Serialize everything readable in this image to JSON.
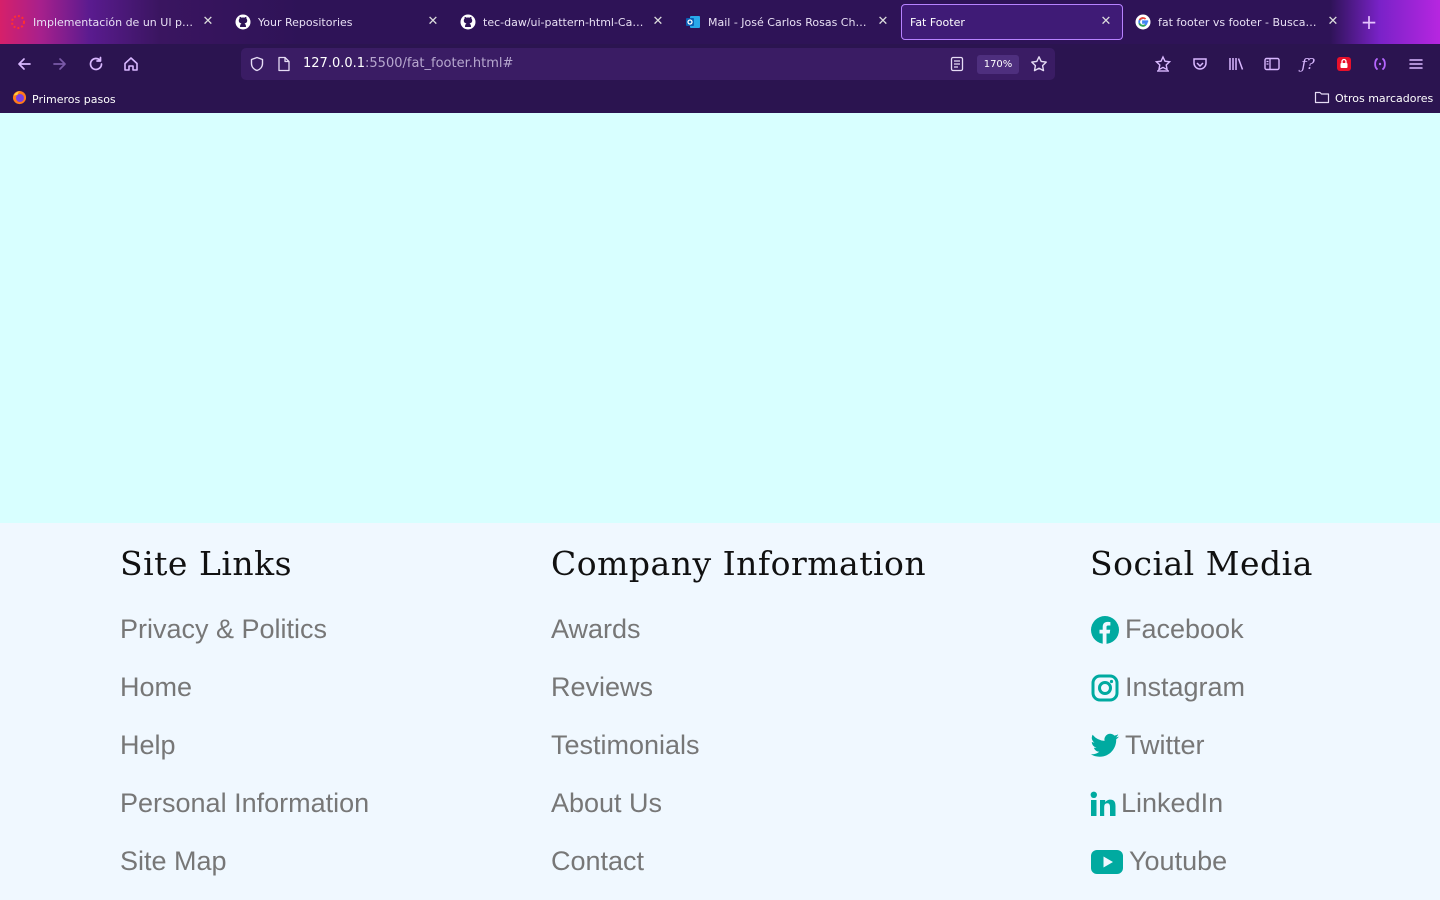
{
  "browser": {
    "tabs": [
      {
        "title": "Implementación de un UI pattern",
        "icon": "ui-pattern-favicon"
      },
      {
        "title": "Your Repositories",
        "icon": "github-icon"
      },
      {
        "title": "tec-daw/ui-pattern-html-CarlosR",
        "icon": "github-icon"
      },
      {
        "title": "Mail - José Carlos Rosas Chapa",
        "icon": "outlook-icon"
      },
      {
        "title": "Fat Footer",
        "icon": "",
        "active": true
      },
      {
        "title": "fat footer vs footer - Buscar con",
        "icon": "google-icon"
      }
    ],
    "url_host": "127.0.0.1",
    "url_path": ":5500/fat_footer.html#",
    "zoom": "170%",
    "bookmarks": {
      "left": "Primeros pasos",
      "right": "Otros marcadores"
    }
  },
  "footer": {
    "site_links": {
      "heading": "Site Links",
      "links": [
        "Privacy & Politics",
        "Home",
        "Help",
        "Personal Information",
        "Site Map"
      ]
    },
    "company": {
      "heading": "Company Information",
      "links": [
        "Awards",
        "Reviews",
        "Testimonials",
        "About Us",
        "Contact"
      ]
    },
    "social": {
      "heading": "Social Media",
      "links": [
        {
          "label": "Facebook",
          "icon": "facebook-icon"
        },
        {
          "label": "Instagram",
          "icon": "instagram-icon"
        },
        {
          "label": "Twitter",
          "icon": "twitter-icon"
        },
        {
          "label": "LinkedIn",
          "icon": "linkedin-icon"
        },
        {
          "label": "Youtube",
          "icon": "youtube-icon"
        }
      ],
      "icon_color": "#00aaa0"
    }
  },
  "colors": {
    "page_background": "#d8ffff",
    "footer_background": "#f0f8ff",
    "browser_chrome": "#2b1450"
  }
}
